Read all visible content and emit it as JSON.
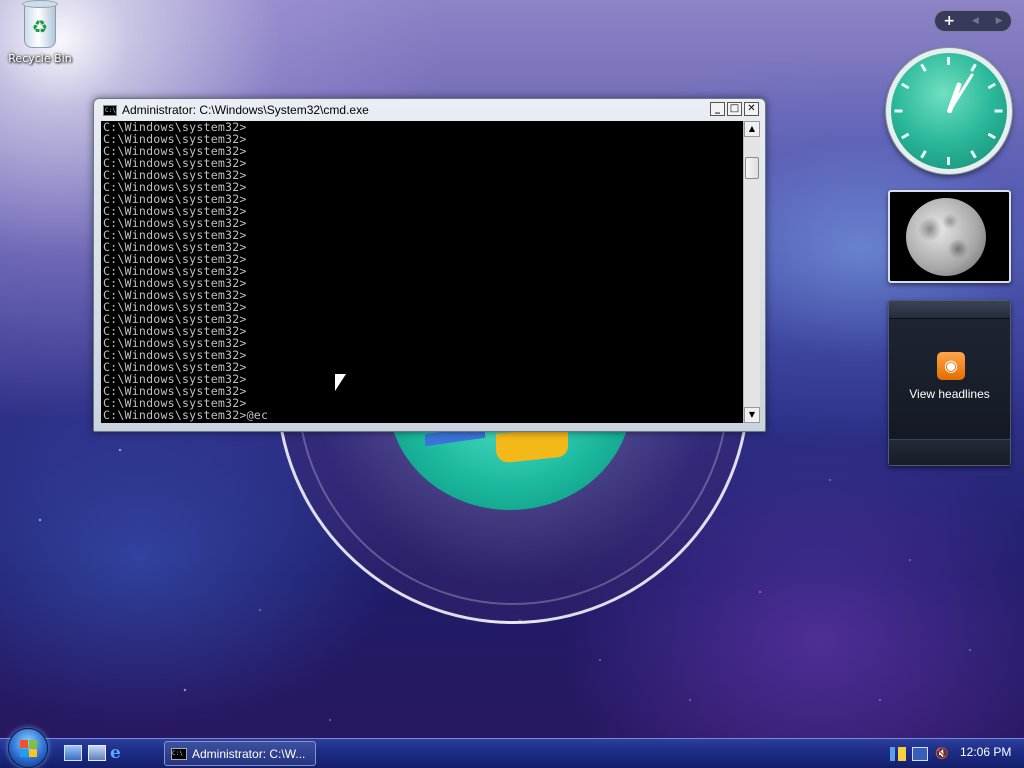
{
  "desktop": {
    "icons": [
      {
        "label": "Recycle Bin",
        "icon": "recycle-bin-icon"
      }
    ]
  },
  "cmd_window": {
    "title": "Administrator: C:\\Windows\\System32\\cmd.exe",
    "prompt_line": "C:\\Windows\\system32>",
    "prompt_count": 24,
    "current_input": "C:\\Windows\\system32>@ec",
    "buttons": {
      "minimize": "_",
      "maximize": "□",
      "close": "✕"
    }
  },
  "sidebar": {
    "control_plus": "+",
    "clock": {
      "hour": 12,
      "minute": 6
    },
    "slideshow": {
      "image": "moon-photo"
    },
    "feed": {
      "label": "View headlines",
      "icon": "rss-icon"
    }
  },
  "taskbar": {
    "start": "start-orb",
    "quick_launch": [
      "show-desktop-icon",
      "switch-windows-icon",
      "internet-explorer-icon"
    ],
    "task_button": {
      "label": "Administrator: C:\\W..."
    },
    "tray": {
      "time": "12:06 PM"
    }
  }
}
